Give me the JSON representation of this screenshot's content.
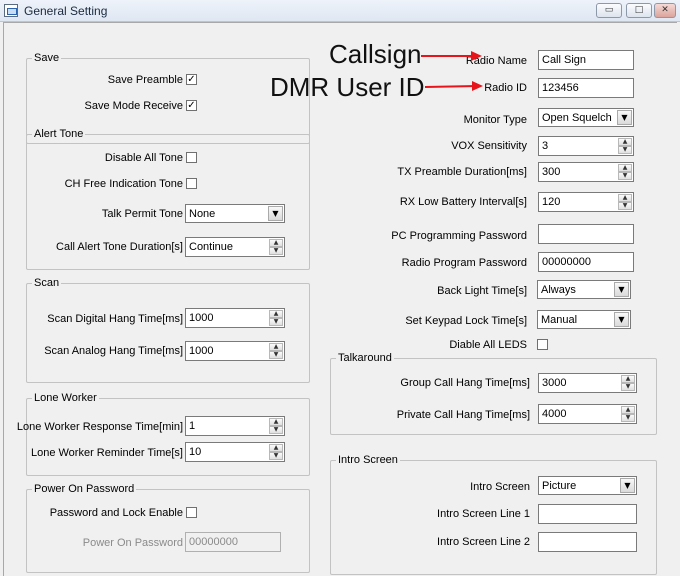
{
  "window": {
    "title": "General Setting",
    "min_glyph": "▭",
    "max_glyph": "□",
    "close_glyph": "✕"
  },
  "annotations": {
    "callsign": "Callsign",
    "dmr_user_id": "DMR User ID",
    "arrow_color": "#e8141b"
  },
  "save": {
    "title": "Save",
    "preamble_label": "Save Preamble",
    "preamble_checked": true,
    "mode_receive_label": "Save Mode Receive",
    "mode_receive_checked": true
  },
  "alert_tone": {
    "title": "Alert Tone",
    "disable_all_label": "Disable All Tone",
    "disable_all_checked": false,
    "ch_free_label": "CH Free Indication Tone",
    "ch_free_checked": false,
    "talk_permit_label": "Talk Permit Tone",
    "talk_permit_value": "None",
    "call_alert_label": "Call Alert Tone Duration[s]",
    "call_alert_value": "Continue"
  },
  "scan": {
    "title": "Scan",
    "digital_label": "Scan Digital Hang Time[ms]",
    "digital_value": "1000",
    "analog_label": "Scan Analog Hang Time[ms]",
    "analog_value": "1000"
  },
  "lone_worker": {
    "title": "Lone Worker",
    "response_label": "Lone Worker Response Time[min]",
    "response_value": "1",
    "reminder_label": "Lone Worker Reminder Time[s]",
    "reminder_value": "10"
  },
  "power_on_password": {
    "title": "Power On Password",
    "lock_label": "Password and Lock Enable",
    "lock_checked": false,
    "password_label": "Power On Password",
    "password_value": "00000000"
  },
  "radio": {
    "name_label": "Radio Name",
    "name_value": "Call Sign",
    "id_label": "Radio ID",
    "id_value": "123456",
    "monitor_label": "Monitor Type",
    "monitor_value": "Open Squelch",
    "vox_label": "VOX Sensitivity",
    "vox_value": "3",
    "tx_preamble_label": "TX Preamble Duration[ms]",
    "tx_preamble_value": "300",
    "rx_battery_label": "RX Low Battery Interval[s]",
    "rx_battery_value": "120",
    "pc_password_label": "PC Programming Password",
    "pc_password_value": "",
    "program_password_label": "Radio Program Password",
    "program_password_value": "00000000",
    "backlight_label": "Back Light Time[s]",
    "backlight_value": "Always",
    "keypad_lock_label": "Set Keypad Lock Time[s]",
    "keypad_lock_value": "Manual",
    "disable_leds_label": "Diable All LEDS",
    "disable_leds_checked": false
  },
  "talkaround": {
    "title": "Talkaround",
    "group_label": "Group Call Hang Time[ms]",
    "group_value": "3000",
    "private_label": "Private Call Hang Time[ms]",
    "private_value": "4000"
  },
  "intro_screen": {
    "title": "Intro Screen",
    "screen_label": "Intro Screen",
    "screen_value": "Picture",
    "line1_label": "Intro Screen Line 1",
    "line1_value": "",
    "line2_label": "Intro Screen Line 2",
    "line2_value": ""
  },
  "glyphs": {
    "check": "✓",
    "combo_arrow": "▼",
    "spin_up": "▲",
    "spin_down": "▼"
  }
}
